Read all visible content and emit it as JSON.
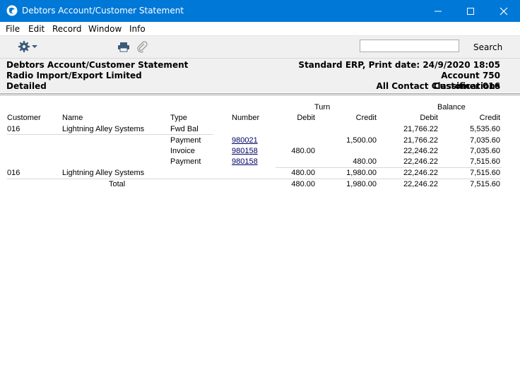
{
  "window": {
    "title": "Debtors Account/Customer Statement"
  },
  "menu": [
    "File",
    "Edit",
    "Record",
    "Window",
    "Info"
  ],
  "toolbar": {
    "search_value": "",
    "search_label": "Search"
  },
  "report_header": {
    "left": [
      "Debtors Account/Customer Statement",
      "Radio Import/Export Limited",
      "Detailed"
    ],
    "print_info": "Standard ERP, Print date: 24/9/2020 18:05",
    "account": "Account  750",
    "contact_line": "All Contact Classifications",
    "contact_overlay": "Customer 016"
  },
  "columns": {
    "group_turn": "Turn",
    "group_balance": "Balance",
    "customer": "Customer",
    "name": "Name",
    "type": "Type",
    "number": "Number",
    "debit": "Debit",
    "credit": "Credit",
    "bal_debit": "Debit",
    "bal_credit": "Credit"
  },
  "rows": [
    {
      "customer": "016",
      "name": "Lightning Alley Systems",
      "type": "Fwd Bal",
      "number": "",
      "debit": "",
      "credit": "",
      "bal_debit": "21,766.22",
      "bal_credit": "5,535.60"
    },
    {
      "customer": "",
      "name": "",
      "type": "Payment",
      "number": "980021",
      "debit": "",
      "credit": "1,500.00",
      "bal_debit": "21,766.22",
      "bal_credit": "7,035.60"
    },
    {
      "customer": "",
      "name": "",
      "type": "Invoice",
      "number": "980158",
      "debit": "480.00",
      "credit": "",
      "bal_debit": "22,246.22",
      "bal_credit": "7,035.60"
    },
    {
      "customer": "",
      "name": "",
      "type": "Payment",
      "number": "980158",
      "debit": "",
      "credit": "480.00",
      "bal_debit": "22,246.22",
      "bal_credit": "7,515.60"
    }
  ],
  "subtotal": {
    "customer": "016",
    "name": "Lightning Alley Systems",
    "debit": "480.00",
    "credit": "1,980.00",
    "bal_debit": "22,246.22",
    "bal_credit": "7,515.60"
  },
  "total": {
    "label": "Total",
    "debit": "480.00",
    "credit": "1,980.00",
    "bal_debit": "22,246.22",
    "bal_credit": "7,515.60"
  }
}
